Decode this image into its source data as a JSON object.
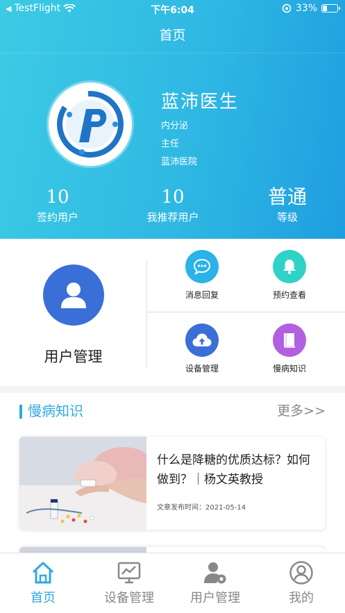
{
  "status_bar": {
    "back_app": "TestFlight",
    "time": "下午6:04",
    "battery_percent": "33%",
    "battery_level": 0.33
  },
  "header": {
    "title": "首页"
  },
  "doctor": {
    "name": "蓝沛医生",
    "department": "内分泌",
    "title": "主任",
    "hospital": "蓝沛医院"
  },
  "stats": [
    {
      "value": "10",
      "label": "签约用户"
    },
    {
      "value": "10",
      "label": "我推荐用户"
    },
    {
      "value": "普通",
      "label": "等级"
    }
  ],
  "actions": {
    "user_management": "用户管理",
    "items": [
      {
        "label": "消息回复",
        "icon": "chat-bubble-icon",
        "color": "#29b3e8"
      },
      {
        "label": "预约查看",
        "icon": "bell-icon",
        "color": "#2fd2c7"
      },
      {
        "label": "设备管理",
        "icon": "cloud-upload-icon",
        "color": "#3b6fd8"
      },
      {
        "label": "慢病知识",
        "icon": "book-icon",
        "color": "#b25fe0"
      }
    ]
  },
  "knowledge": {
    "section_title": "慢病知识",
    "more": "更多>>",
    "articles": [
      {
        "title": "什么是降糖的优质达标？如何做到？｜杨文英教授",
        "date_label": "文章发布时间：2021-05-14"
      }
    ]
  },
  "tabbar": [
    {
      "label": "首页",
      "icon": "home-icon",
      "active": true
    },
    {
      "label": "设备管理",
      "icon": "monitor-chart-icon",
      "active": false
    },
    {
      "label": "用户管理",
      "icon": "user-gear-icon",
      "active": false
    },
    {
      "label": "我的",
      "icon": "profile-icon",
      "active": false
    }
  ],
  "colors": {
    "accent": "#2fa9e0",
    "header_gradient_start": "#3ccbe4",
    "header_gradient_end": "#1f9ee0"
  }
}
